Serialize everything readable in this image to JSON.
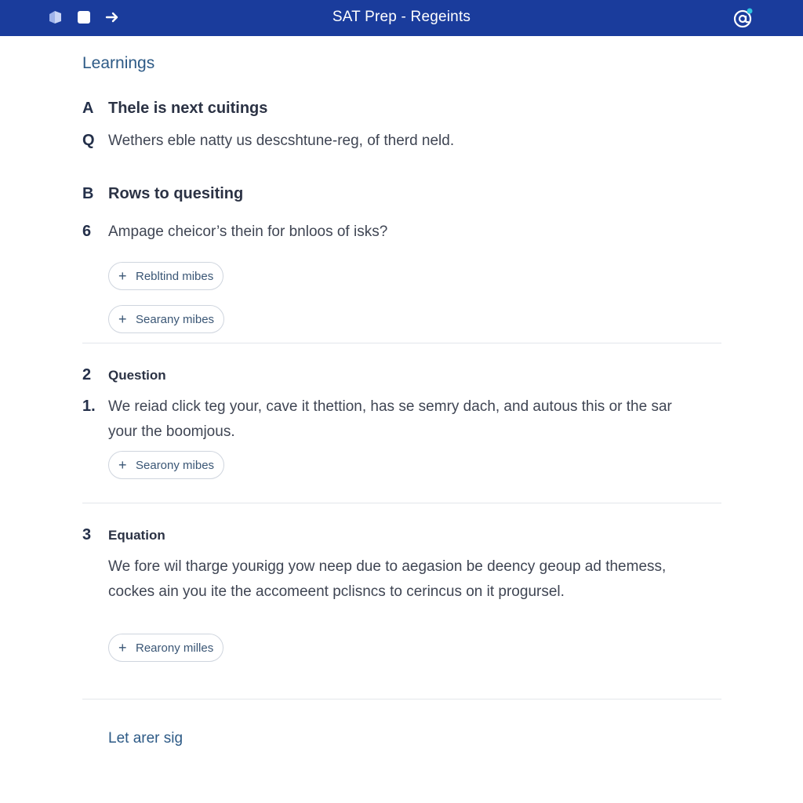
{
  "header": {
    "title": "SAT Prep  -  Regeints",
    "icons": [
      "cube-icon",
      "square-icon",
      "arrow-right-icon",
      "at-sign-icon"
    ],
    "bar_color": "#1a3c9c",
    "badge_color": "#2ec4e0"
  },
  "learnings": {
    "title": "Learnings",
    "items": [
      {
        "marker": "A",
        "text": "Thele is next cuitings"
      },
      {
        "marker": "Q",
        "text": "Wethers eble natty us descshtune-reg, of therd neld."
      },
      {
        "marker": "B",
        "text": "Rows to quesiting"
      },
      {
        "marker": "6",
        "text": "Ampage cheicor’s thein for bnloos of isks?"
      }
    ],
    "pills": [
      {
        "label": "Rebltind mibes"
      },
      {
        "label": "Searany mibes"
      }
    ]
  },
  "question": {
    "number": "2",
    "label": "Question",
    "item_marker": "1.",
    "text": "We reiad  click teg your, cave it thettion, has se semry dach, and autous this or  the sar your the boomjous.",
    "pill_label": "Searony mibes"
  },
  "equation": {
    "number": "3",
    "label": "Equation",
    "text": "We fore wil tharge youʀigg yow neep due to aegasion be deency geoup ad themess, cockes ain you ite the accomeent pclisncs to cerincus on it progursel.",
    "pill_label": "Rearony milles"
  },
  "footer": {
    "link": "Let arer sig"
  }
}
